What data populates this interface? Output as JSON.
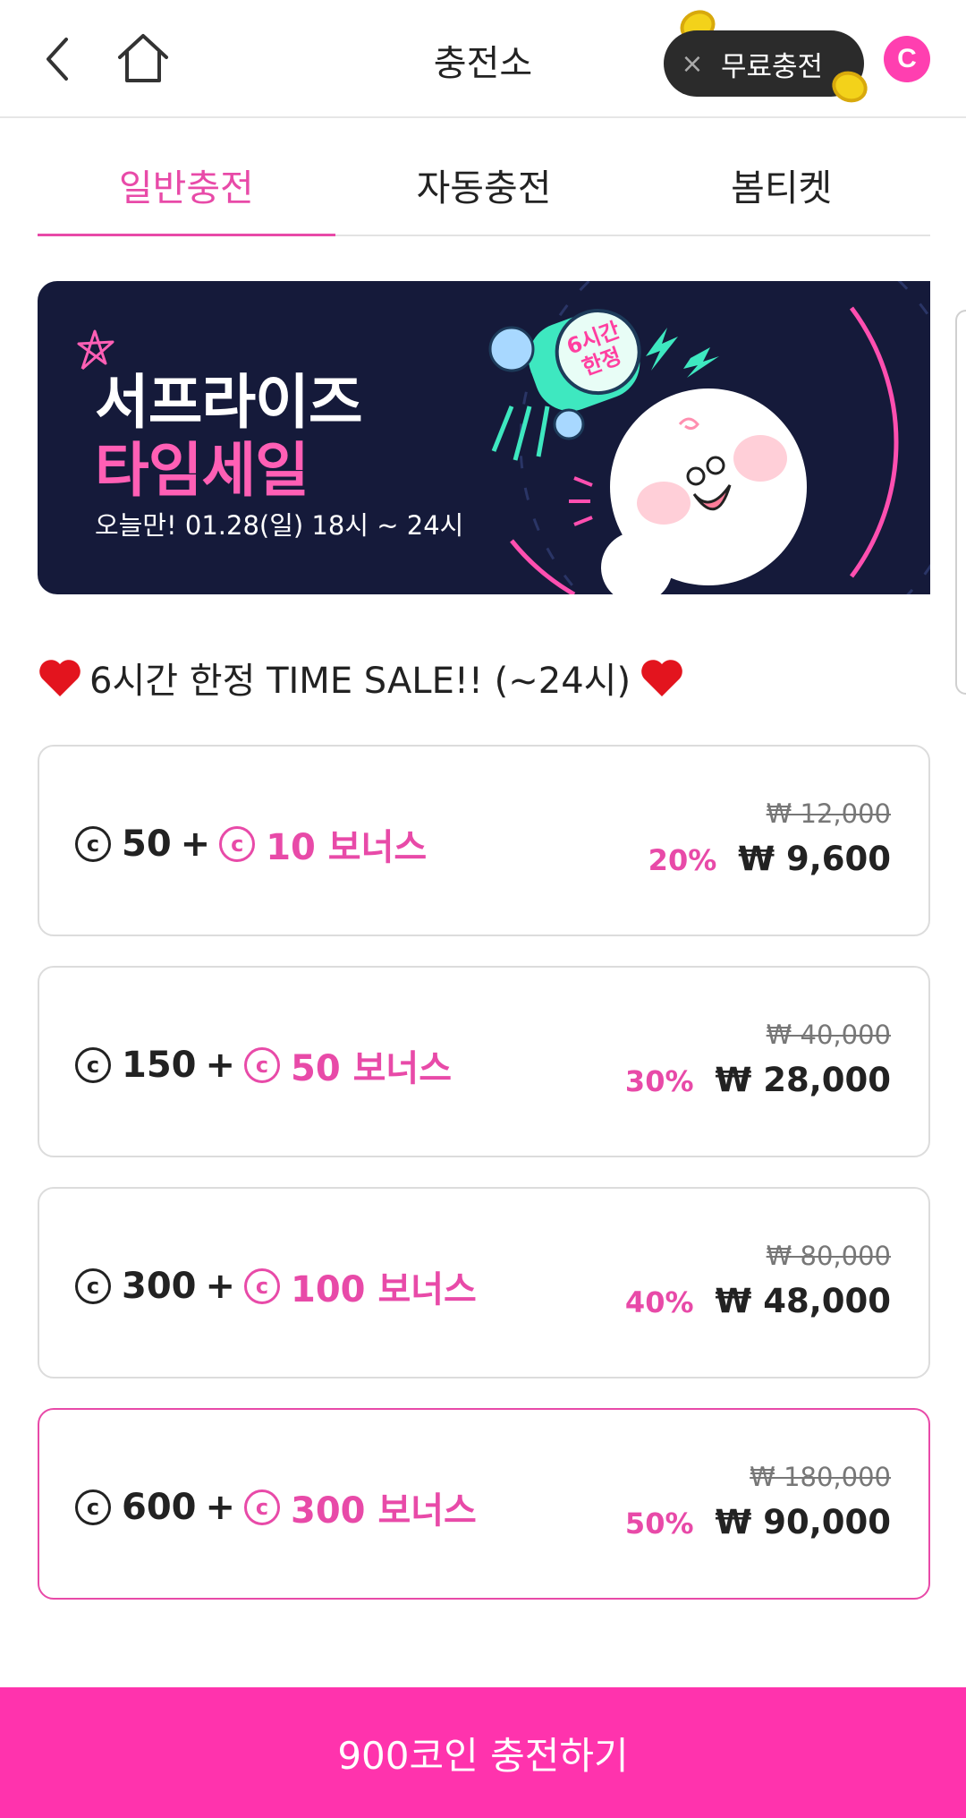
{
  "header": {
    "title": "충전소",
    "free_charge_label": "무료충전",
    "free_charge_close": "×",
    "profile_initial": "C"
  },
  "tabs": [
    {
      "label": "일반충전",
      "active": true
    },
    {
      "label": "자동충전",
      "active": false
    },
    {
      "label": "봄티켓",
      "active": false
    }
  ],
  "banner": {
    "title_line1": "서프라이즈",
    "title_line2": "타임세일",
    "subtitle": "오늘만! 01.28(일) 18시 ~ 24시",
    "badge_line1": "6시간",
    "badge_line2": "한정"
  },
  "section": {
    "heading": "6시간 한정 TIME SALE!! (~24시)"
  },
  "coin_symbol": "c",
  "products": [
    {
      "coins": "50",
      "plus": "+",
      "bonus": "10 보너스",
      "original_price": "₩ 12,000",
      "discount": "20%",
      "price": "₩ 9,600",
      "selected": false
    },
    {
      "coins": "150",
      "plus": "+",
      "bonus": "50 보너스",
      "original_price": "₩ 40,000",
      "discount": "30%",
      "price": "₩ 28,000",
      "selected": false
    },
    {
      "coins": "300",
      "plus": "+",
      "bonus": "100 보너스",
      "original_price": "₩ 80,000",
      "discount": "40%",
      "price": "₩ 48,000",
      "selected": false
    },
    {
      "coins": "600",
      "plus": "+",
      "bonus": "300 보너스",
      "original_price": "₩ 180,000",
      "discount": "50%",
      "price": "₩ 90,000",
      "selected": true
    }
  ],
  "cta": {
    "label": "900코인 충전하기"
  },
  "colors": {
    "accent": "#e84aa8",
    "cta": "#ff33ad",
    "banner_bg": "#151a3a"
  }
}
